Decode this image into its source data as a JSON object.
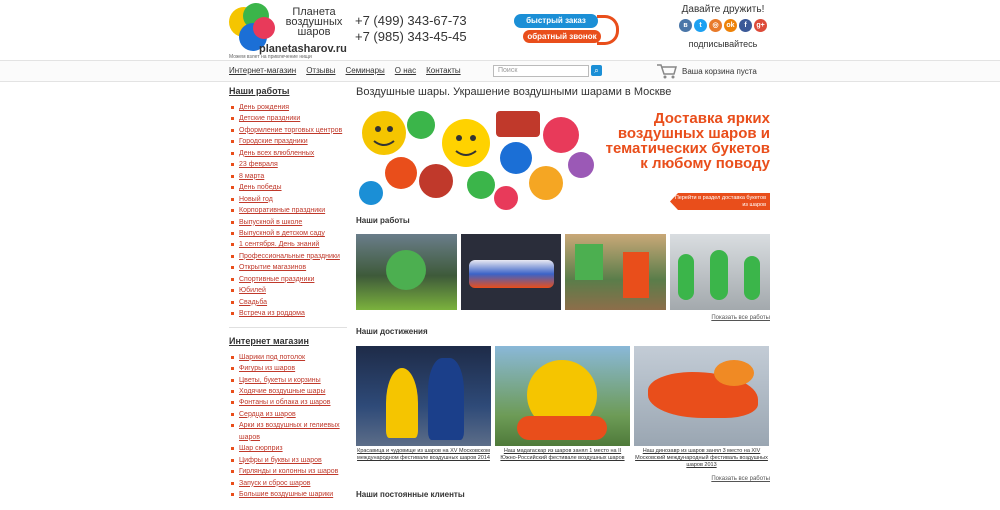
{
  "header": {
    "logo_name": "Планета воздушных шаров",
    "logo_site": "planetasharov.ru",
    "logo_tagline": "Можем взлет на привлечение нищи",
    "phone1": "+7 (499) 343-67-73",
    "phone2": "+7 (985) 343-45-45",
    "quick_order": "быстрый заказ",
    "callback": "обратный звонок",
    "social_title": "Давайте дружить!",
    "social_sub": "подписывайтесь",
    "social_icons": [
      "vk-icon",
      "twitter-icon",
      "instagram-icon",
      "odnoklassniki-icon",
      "facebook-icon",
      "googleplus-icon"
    ]
  },
  "nav": {
    "links": [
      "Интернет-магазин",
      "Отзывы",
      "Семинары",
      "О нас",
      "Контакты"
    ],
    "search_placeholder": "Поиск",
    "cart_text": "Ваша корзина пуста"
  },
  "sidebar": {
    "works_title": "Наши работы",
    "works_items": [
      "День рождения",
      "Детские праздники",
      "Оформление торговых центров",
      "Городские праздники",
      "День всех влюбленных",
      "23 февраля",
      "8 марта",
      "День победы",
      "Новый год",
      "Корпоративные праздники",
      "Выпускной в школе",
      "Выпускной в детском саду",
      "1 сентября. День знаний",
      "Профессиональные праздники",
      "Открытие магазинов",
      "Спортивные праздники",
      "Юбилей",
      "Свадьба",
      "Встреча из роддома"
    ],
    "shop_title": "Интернет магазин",
    "shop_items": [
      "Шарики под потолок",
      "Фигуры из шаров",
      "Цветы, букеты и корзины",
      "Ходячие воздушные шары",
      "Фонтаны и облака из шаров",
      "Сердца из шаров",
      "Арки из воздушных и гелиевых шаров",
      "Шар сюрприз",
      "Цифры и буквы из шаров",
      "Гирлянды и колонны из шаров",
      "Запуск и сброс шаров",
      "Большие воздушные шарики"
    ]
  },
  "main": {
    "title": "Воздушные шары. Украшение воздушными шарами в Москве",
    "banner_text": "Доставка ярких воздушных шаров и тематических букетов к любому поводу",
    "banner_button": "Перейти в раздел доставка букетов из шаров",
    "works_title": "Наши работы",
    "works_show_all": "Показать все работы",
    "achievements_title": "Наши достижения",
    "achievements": [
      "Красавица и чудовище из шаров на XV Московском международном фестивале воздушных шаров 2014",
      "Наш мадагаскар из шаров занял 1 место на II Южно-Российский фестивале воздушных шаров",
      "Наш динозавр из шаров занял 3 место на XIV Московский международный фестиваль воздушных шаров 2013"
    ],
    "achievements_show_all": "Показать все работы",
    "clients_title": "Наши постоянные клиенты"
  },
  "colors": {
    "accent": "#e94e1b",
    "link": "#c0392b",
    "blue": "#1b8fd6"
  }
}
